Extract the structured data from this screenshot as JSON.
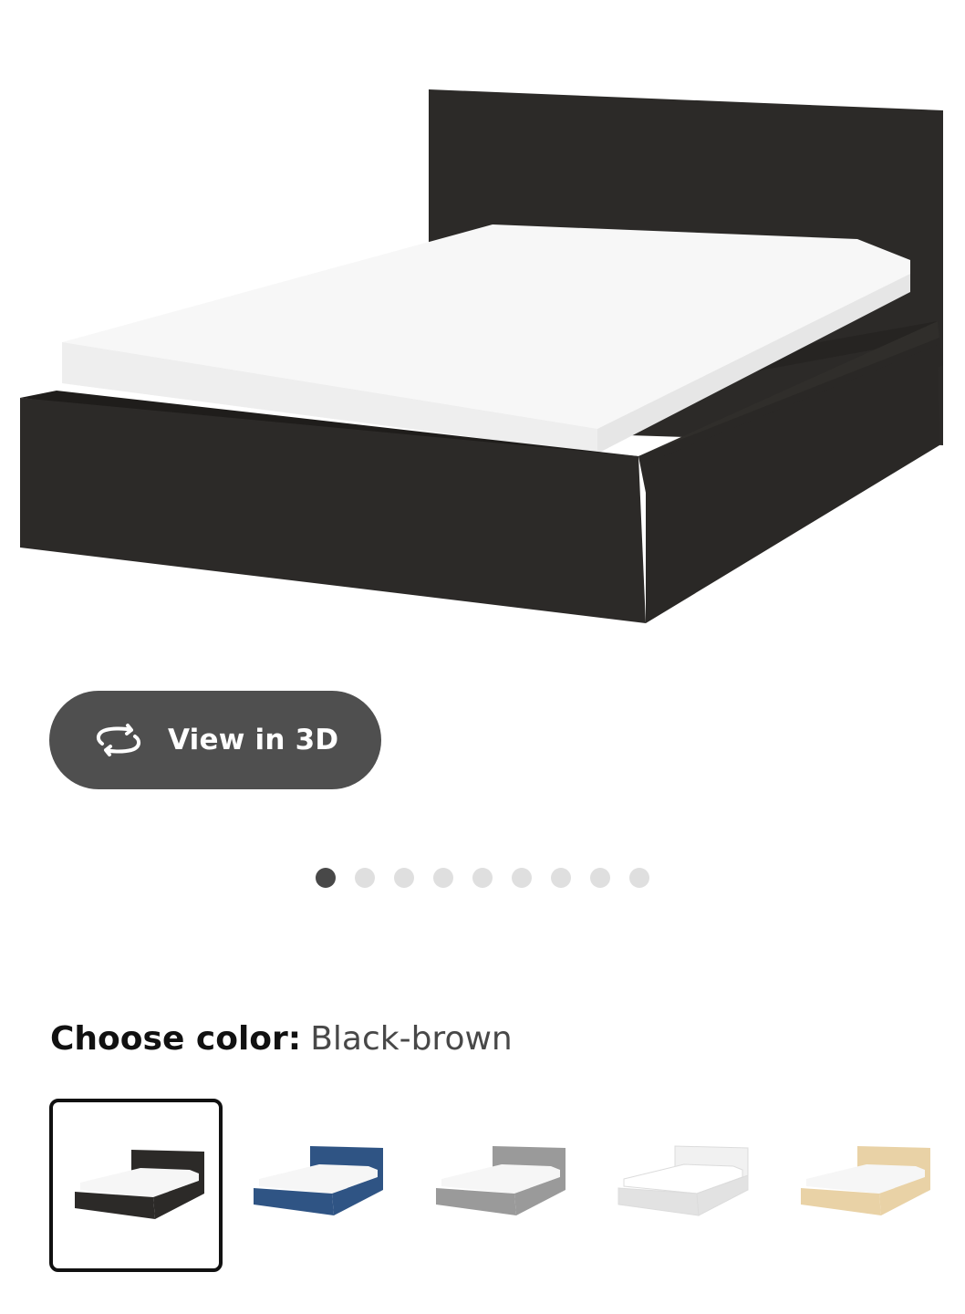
{
  "product_image": {
    "alt_icon": "bed-image",
    "frame_color": "#2c2a28",
    "mattress_color": "#f6f6f6"
  },
  "view_3d_button": {
    "icon": "rotate-3d-icon",
    "label": "View in 3D"
  },
  "carousel": {
    "total_slides": 9,
    "active_index": 0
  },
  "color_selector": {
    "label": "Choose color:",
    "selected_value": "Black-brown",
    "options": [
      {
        "color": "#2c2a28",
        "selected": true
      },
      {
        "color": "#2f5484",
        "selected": false
      },
      {
        "color": "#9a9a9a",
        "selected": false
      },
      {
        "color": "#f1f1f1",
        "selected": false
      },
      {
        "color": "#e9d2a6",
        "selected": false
      }
    ]
  }
}
